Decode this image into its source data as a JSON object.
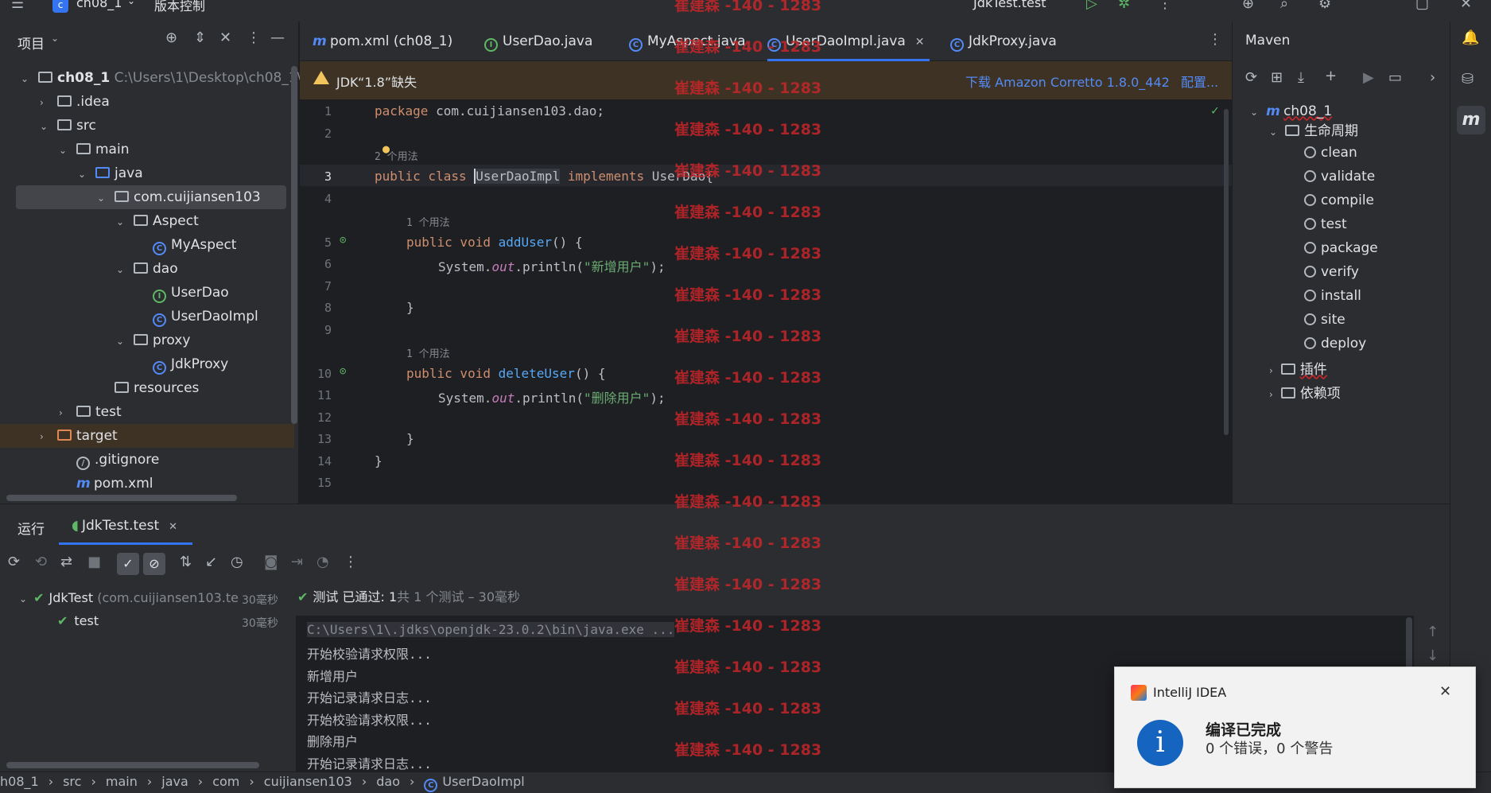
{
  "topbar": {
    "project": "ch08_1",
    "vcs": "版本控制",
    "run_config": "JdkTest.test"
  },
  "project_panel": {
    "title": "项目",
    "tree": [
      {
        "label": "ch08_1",
        "extra": "C:\\Users\\1\\Desktop\\ch08_1\\ch",
        "type": "module",
        "depth": 0,
        "arrow": "down"
      },
      {
        "label": ".idea",
        "type": "folder",
        "depth": 1,
        "arrow": "right"
      },
      {
        "label": "src",
        "type": "folder",
        "depth": 1,
        "arrow": "down"
      },
      {
        "label": "main",
        "type": "folder",
        "depth": 2,
        "arrow": "down"
      },
      {
        "label": "java",
        "type": "folder",
        "depth": 3,
        "arrow": "down"
      },
      {
        "label": "com.cuijiansen103",
        "type": "package",
        "depth": 4,
        "arrow": "down"
      },
      {
        "label": "Aspect",
        "type": "package",
        "depth": 5,
        "arrow": "down"
      },
      {
        "label": "MyAspect",
        "type": "class",
        "depth": 6,
        "arrow": ""
      },
      {
        "label": "dao",
        "type": "package",
        "depth": 5,
        "arrow": "down"
      },
      {
        "label": "UserDao",
        "type": "interface",
        "depth": 6,
        "arrow": ""
      },
      {
        "label": "UserDaoImpl",
        "type": "class",
        "depth": 6,
        "arrow": ""
      },
      {
        "label": "proxy",
        "type": "package",
        "depth": 5,
        "arrow": "down"
      },
      {
        "label": "JdkProxy",
        "type": "class",
        "depth": 6,
        "arrow": ""
      },
      {
        "label": "resources",
        "type": "folder",
        "depth": 4,
        "arrow": ""
      },
      {
        "label": "test",
        "type": "folder",
        "depth": 2,
        "arrow": "right"
      },
      {
        "label": "target",
        "type": "folder-excluded",
        "depth": 1,
        "arrow": "right"
      },
      {
        "label": ".gitignore",
        "type": "ignore",
        "depth": 2,
        "arrow": ""
      },
      {
        "label": "pom.xml",
        "type": "maven",
        "depth": 2,
        "arrow": ""
      }
    ]
  },
  "tabs": [
    {
      "label": "pom.xml (ch08_1)",
      "icon": "maven-icon"
    },
    {
      "label": "UserDao.java",
      "icon": "interface-icon"
    },
    {
      "label": "MyAspect.java",
      "icon": "class-icon"
    },
    {
      "label": "UserDaoImpl.java",
      "icon": "class-icon",
      "active": true
    },
    {
      "label": "JdkProxy.java",
      "icon": "class-icon"
    }
  ],
  "banner": {
    "text": "JDK“1.8”缺失",
    "download": "下载 Amazon Corretto 1.8.0_442",
    "configure": "配置..."
  },
  "editor": {
    "lines": [
      "1",
      "2",
      "3",
      "4",
      "5",
      "6",
      "7",
      "8",
      "9",
      "10",
      "11",
      "12",
      "13",
      "14",
      "15"
    ],
    "hint2": "2 个用法",
    "hint1": "1 个用法",
    "hint1b": "1 个用法",
    "c1_kw": "package",
    "c1_rest": " com.cuijiansen103.dao;",
    "c3_kw": "public class",
    "c3_name": "UserDaoImpl",
    "c3_kw2": "implements",
    "c3_rest": " UserDao{",
    "c5_kw": "public void",
    "c5_fn": "addUser",
    "c5_rest": "() {",
    "c6_a": "System.",
    "c6_it": "out",
    "c6_b": ".println(",
    "c6_str": "\"新增用户\"",
    "c6_c": ");",
    "c8": "}",
    "c10_kw": "public void",
    "c10_fn": "deleteUser",
    "c10_rest": "() {",
    "c11_a": "System.",
    "c11_it": "out",
    "c11_b": ".println(",
    "c11_str": "\"删除用户\"",
    "c11_c": ");",
    "c13": "}",
    "c14": "}"
  },
  "maven": {
    "title": "Maven",
    "project": "ch08_1",
    "lifecycle": "生命周期",
    "goals": [
      "clean",
      "validate",
      "compile",
      "test",
      "package",
      "verify",
      "install",
      "site",
      "deploy"
    ],
    "plugins": "插件",
    "deps": "依赖项"
  },
  "run": {
    "tab_run": "运行",
    "tab_config": "JdkTest.test",
    "tree_root": "JdkTest",
    "tree_root_pkg": "(com.cuijiansen103.te",
    "tree_root_time": "30毫秒",
    "tree_child": "test",
    "tree_child_time": "30毫秒",
    "summary_a": "测试 已通过: 1",
    "summary_b": "共 1 个测试 – 30毫秒",
    "output": [
      "C:\\Users\\1\\.jdks\\openjdk-23.0.2\\bin\\java.exe ...",
      "开始校验请求权限...",
      "新增用户",
      "开始记录请求日志...",
      "开始校验请求权限...",
      "删除用户",
      "开始记录请求日志..."
    ]
  },
  "statusbar": {
    "crumbs": [
      "h08_1",
      "src",
      "main",
      "java",
      "com",
      "cuijiansen103",
      "dao",
      "UserDaoImpl"
    ]
  },
  "notification": {
    "app": "IntelliJ IDEA",
    "title": "编译已完成",
    "body": "0 个错误，0 个警告"
  },
  "watermark": "崔建森 -140 - 1283"
}
